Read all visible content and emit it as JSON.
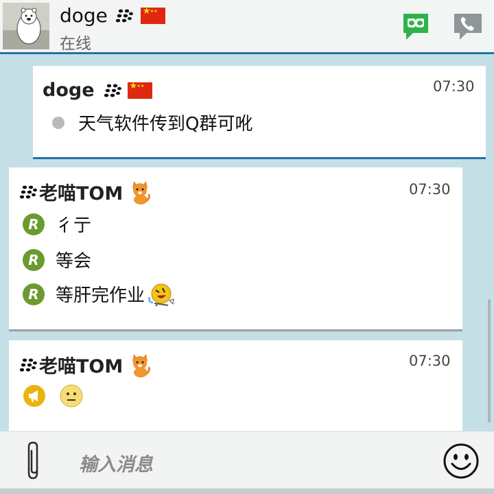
{
  "header": {
    "contact_name": "doge",
    "status": "在线"
  },
  "messages": [
    {
      "sender": "doge",
      "time": "07:30",
      "lines": [
        "天气软件传到Q群可吪"
      ]
    },
    {
      "sender": "老喵TOM",
      "time": "07:30",
      "lines": [
        "彳亍",
        "等会",
        "等肝完作业"
      ]
    },
    {
      "sender": "老喵TOM",
      "time": "07:30",
      "lines": []
    }
  ],
  "composer": {
    "placeholder": "输入消息"
  },
  "colors": {
    "accent_blue": "#1e74a6",
    "read_badge_green": "#6b9a2f",
    "video_icon_green": "#2db34a"
  },
  "icons": [
    "bbm-icon",
    "china-flag-icon",
    "video-chat-icon",
    "phone-icon",
    "cat-emoji-icon",
    "rolling-laugh-emoji-icon",
    "broadcast-icon",
    "neutral-face-emoji-icon",
    "paperclip-icon",
    "smiley-icon"
  ]
}
